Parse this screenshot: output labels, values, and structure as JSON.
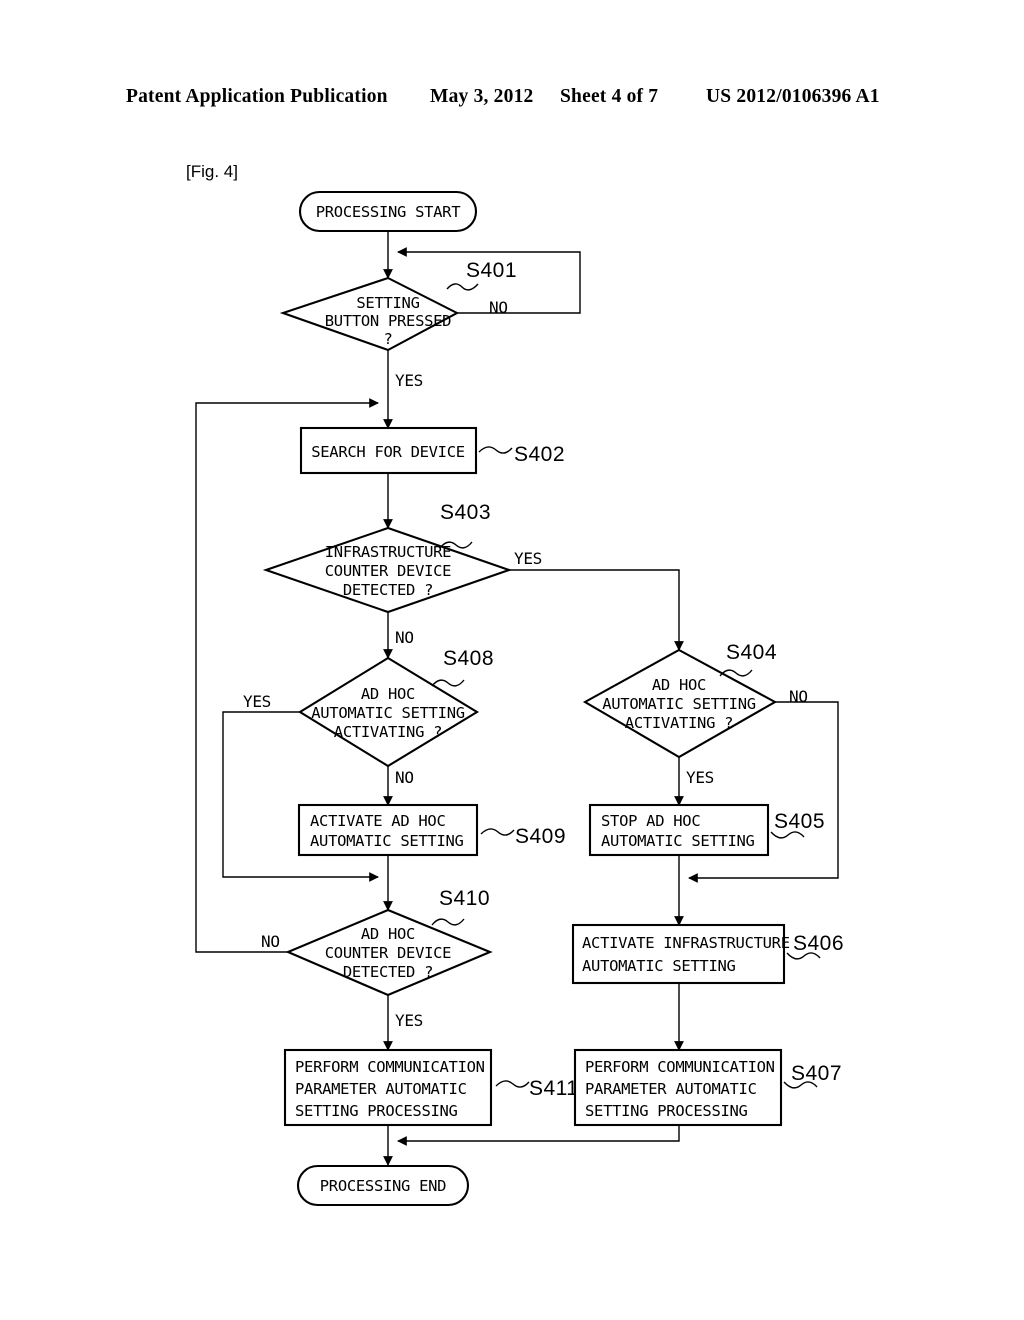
{
  "header": {
    "publication": "Patent Application Publication",
    "date": "May 3, 2012",
    "sheet": "Sheet 4 of 7",
    "patent_number": "US 2012/0106396 A1"
  },
  "figure": {
    "label": "[Fig. 4]"
  },
  "flowchart": {
    "type": "flowchart",
    "nodes": [
      {
        "id": "start",
        "shape": "terminator",
        "step": "",
        "lines": [
          "PROCESSING START"
        ]
      },
      {
        "id": "s401",
        "shape": "decision",
        "step": "S401",
        "lines": [
          "SETTING",
          "BUTTON PRESSED",
          "?"
        ]
      },
      {
        "id": "s402",
        "shape": "process",
        "step": "S402",
        "lines": [
          "SEARCH FOR DEVICE"
        ]
      },
      {
        "id": "s403",
        "shape": "decision",
        "step": "S403",
        "lines": [
          "INFRASTRUCTURE",
          "COUNTER DEVICE",
          "DETECTED ?"
        ]
      },
      {
        "id": "s408",
        "shape": "decision",
        "step": "S408",
        "lines": [
          "AD HOC",
          "AUTOMATIC SETTING",
          "ACTIVATING ?"
        ]
      },
      {
        "id": "s404",
        "shape": "decision",
        "step": "S404",
        "lines": [
          "AD HOC",
          "AUTOMATIC SETTING",
          "ACTIVATING ?"
        ]
      },
      {
        "id": "s409",
        "shape": "process",
        "step": "S409",
        "lines": [
          "ACTIVATE AD HOC",
          "AUTOMATIC SETTING"
        ]
      },
      {
        "id": "s405",
        "shape": "process",
        "step": "S405",
        "lines": [
          "STOP AD HOC",
          "AUTOMATIC SETTING"
        ]
      },
      {
        "id": "s410",
        "shape": "decision",
        "step": "S410",
        "lines": [
          "AD HOC",
          "COUNTER DEVICE",
          "DETECTED ?"
        ]
      },
      {
        "id": "s406",
        "shape": "process",
        "step": "S406",
        "lines": [
          "ACTIVATE INFRASTRUCTURE",
          "AUTOMATIC SETTING"
        ]
      },
      {
        "id": "s411",
        "shape": "process",
        "step": "S411",
        "lines": [
          "PERFORM COMMUNICATION",
          "PARAMETER AUTOMATIC",
          "SETTING PROCESSING"
        ]
      },
      {
        "id": "s407",
        "shape": "process",
        "step": "S407",
        "lines": [
          "PERFORM COMMUNICATION",
          "PARAMETER AUTOMATIC",
          "SETTING PROCESSING"
        ]
      },
      {
        "id": "end",
        "shape": "terminator",
        "step": "",
        "lines": [
          "PROCESSING END"
        ]
      }
    ],
    "edge_labels": {
      "s401_no": "NO",
      "s401_yes": "YES",
      "s403_yes": "YES",
      "s403_no": "NO",
      "s408_yes": "YES",
      "s408_no": "NO",
      "s404_no": "NO",
      "s404_yes": "YES",
      "s410_no": "NO",
      "s410_yes": "YES"
    },
    "node_text": {
      "start_l1": "PROCESSING START",
      "s401_l1": "SETTING",
      "s401_l2": "BUTTON PRESSED",
      "s401_l3": "?",
      "s402_l1": "SEARCH FOR DEVICE",
      "s403_l1": "INFRASTRUCTURE",
      "s403_l2": "COUNTER DEVICE",
      "s403_l3": "DETECTED ?",
      "s408_l1": "AD HOC",
      "s408_l2": "AUTOMATIC SETTING",
      "s408_l3": "ACTIVATING ?",
      "s404_l1": "AD HOC",
      "s404_l2": "AUTOMATIC SETTING",
      "s404_l3": "ACTIVATING ?",
      "s409_l1": "ACTIVATE AD HOC",
      "s409_l2": "AUTOMATIC SETTING",
      "s405_l1": "STOP AD HOC",
      "s405_l2": "AUTOMATIC SETTING",
      "s410_l1": "AD HOC",
      "s410_l2": "COUNTER DEVICE",
      "s410_l3": "DETECTED ?",
      "s406_l1": "ACTIVATE INFRASTRUCTURE",
      "s406_l2": "AUTOMATIC SETTING",
      "s411_l1": "PERFORM COMMUNICATION",
      "s411_l2": "PARAMETER AUTOMATIC",
      "s411_l3": "SETTING PROCESSING",
      "s407_l1": "PERFORM COMMUNICATION",
      "s407_l2": "PARAMETER AUTOMATIC",
      "s407_l3": "SETTING PROCESSING",
      "end_l1": "PROCESSING END"
    },
    "step_ids": {
      "s401": "S401",
      "s402": "S402",
      "s403": "S403",
      "s404": "S404",
      "s405": "S405",
      "s406": "S406",
      "s407": "S407",
      "s408": "S408",
      "s409": "S409",
      "s410": "S410",
      "s411": "S411"
    }
  },
  "colors": {
    "ink": "#000000",
    "paper": "#ffffff"
  }
}
